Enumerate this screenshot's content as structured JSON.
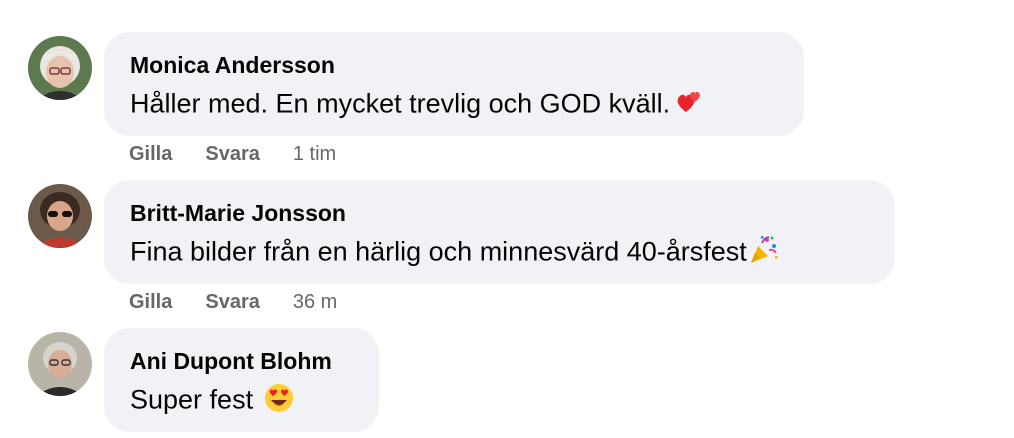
{
  "comments": [
    {
      "author": "Monica Andersson",
      "text": "Håller med. En mycket trevlig och GOD kväll.",
      "emoji": "two-hearts-icon",
      "like_label": "Gilla",
      "reply_label": "Svara",
      "timestamp": "1 tim"
    },
    {
      "author": "Britt-Marie Jonsson",
      "text": "Fina bilder från en härlig och minnesvärd 40-årsfest",
      "emoji": "party-popper-icon",
      "like_label": "Gilla",
      "reply_label": "Svara",
      "timestamp": "36 m"
    },
    {
      "author": "Ani Dupont Blohm",
      "text": "Super fest",
      "emoji": "heart-eyes-face-icon"
    }
  ],
  "colors": {
    "bubble_bg": "#f0f2f5",
    "meta_text": "#65676b",
    "primary_text": "#050505"
  }
}
